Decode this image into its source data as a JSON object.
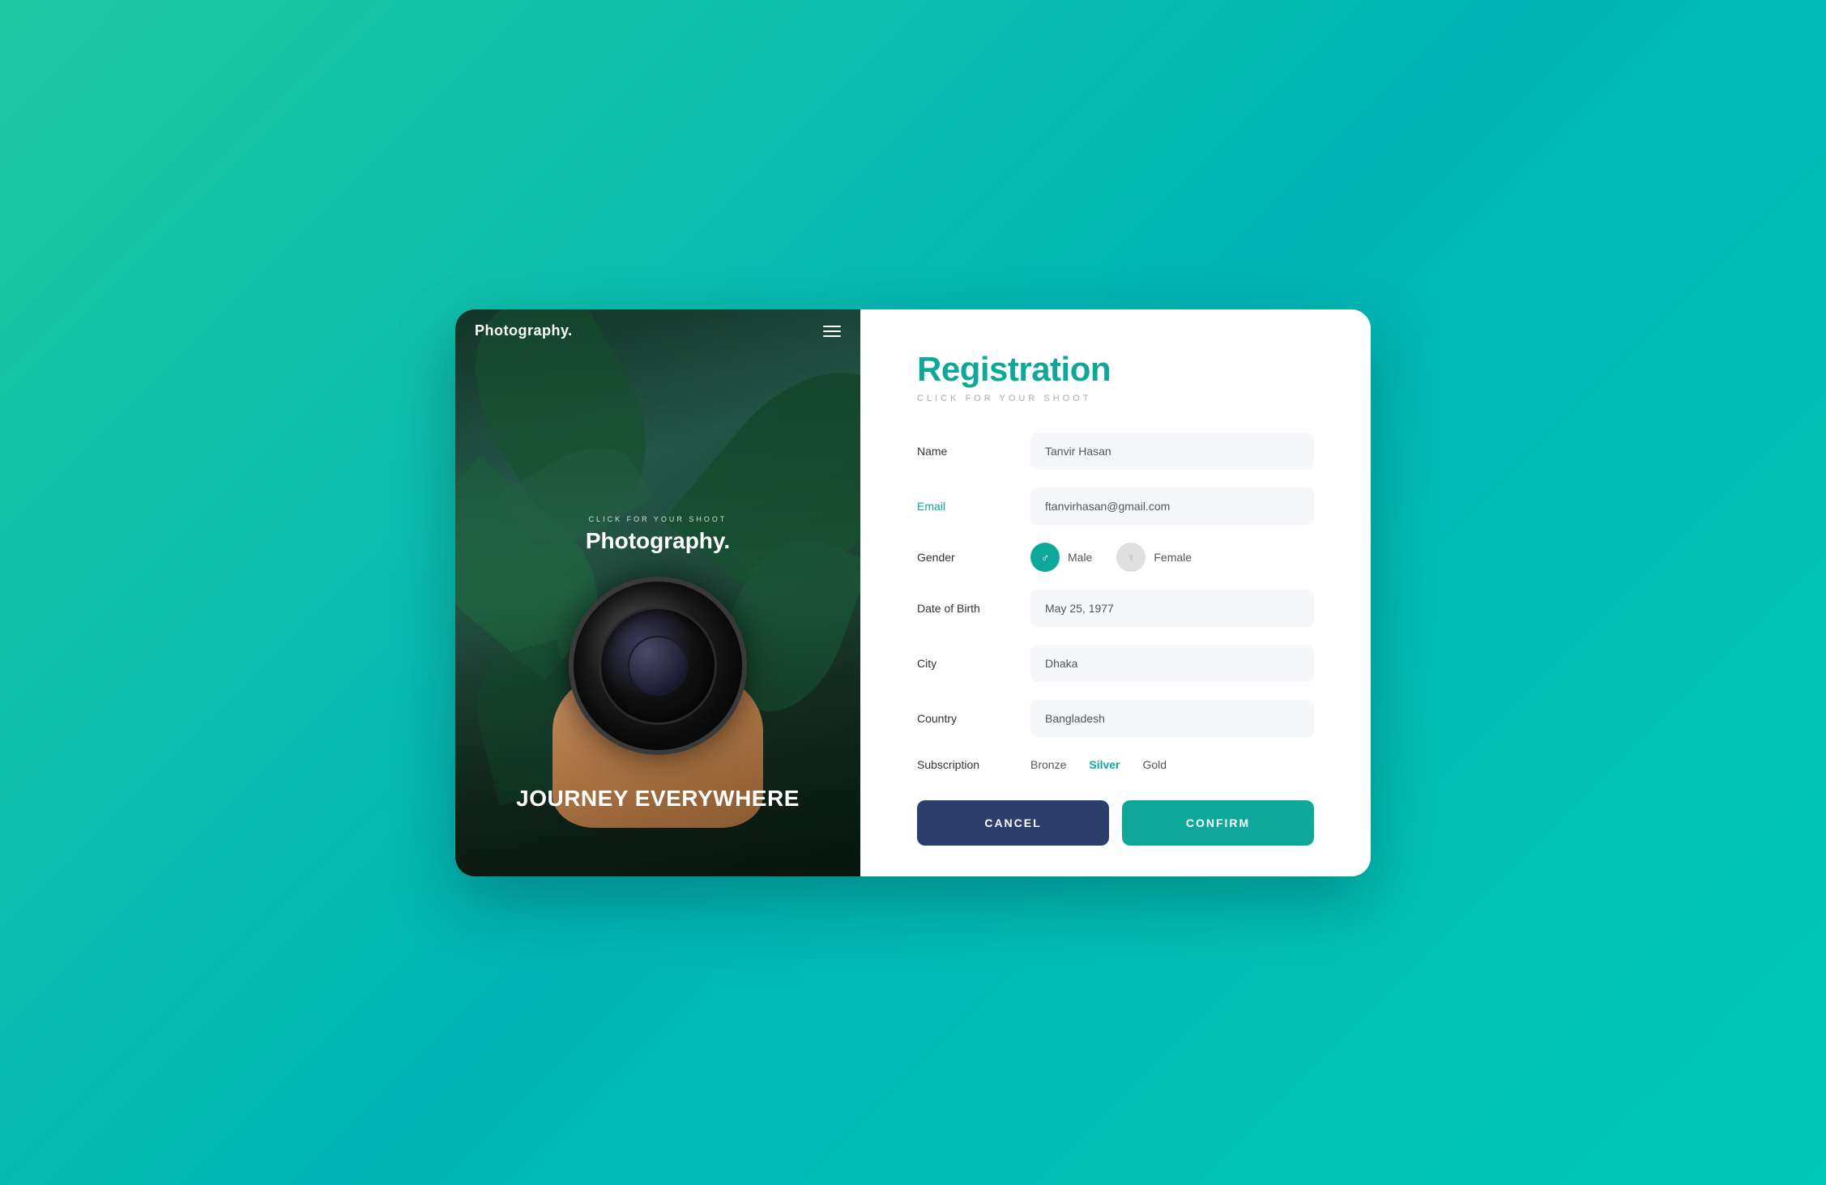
{
  "brand": {
    "logo": "Photography.",
    "tagline_sub": "CLICK FOR YOUR SHOOT",
    "tagline_title": "Photography.",
    "journey_text": "JOURNEY EVERYWHERE"
  },
  "registration": {
    "title": "Registration",
    "subtitle": "CLICK FOR YOUR SHOOT",
    "fields": {
      "name": {
        "label": "Name",
        "placeholder": "Tanvir Hasan",
        "value": "Tanvir Hasan"
      },
      "email": {
        "label": "Email",
        "placeholder": "ftanvirhasan@gmail.com",
        "value": "ftanvirhasan@gmail.com"
      },
      "gender": {
        "label": "Gender",
        "options": [
          "Male",
          "Female"
        ],
        "selected": "Male"
      },
      "dob": {
        "label": "Date of Birth",
        "placeholder": "May 25, 1977",
        "value": "May 25, 1977"
      },
      "city": {
        "label": "City",
        "placeholder": "Dhaka",
        "value": "Dhaka"
      },
      "country": {
        "label": "Country",
        "placeholder": "Bangladesh",
        "value": "Bangladesh"
      },
      "subscription": {
        "label": "Subscription",
        "options": [
          "Bronze",
          "Silver",
          "Gold"
        ],
        "selected": "Silver"
      }
    },
    "buttons": {
      "cancel": "CANCEL",
      "confirm": "CONFIRM"
    }
  },
  "colors": {
    "teal": "#0da89a",
    "dark_blue": "#2c3e6e",
    "label_teal": "#0da89a"
  }
}
